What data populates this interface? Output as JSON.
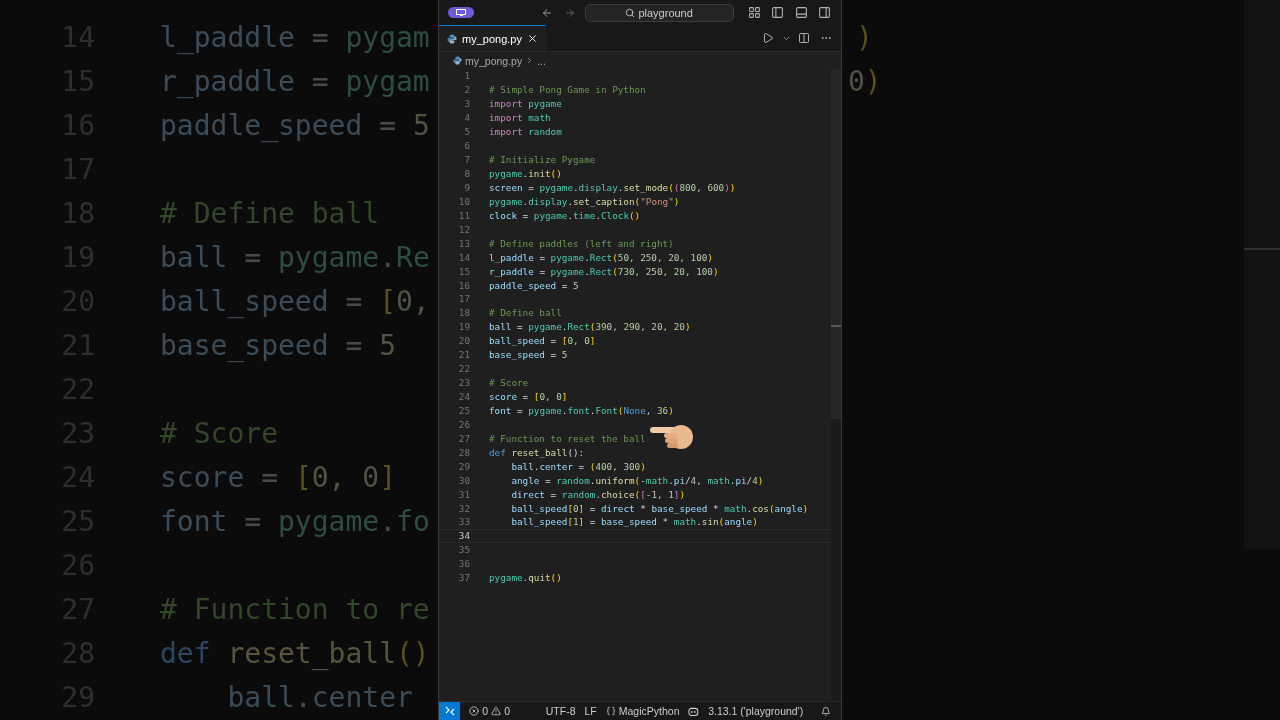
{
  "background": {
    "left_lines": [
      {
        "number": "14",
        "tokens": [
          {
            "text": "l_paddle",
            "kind": "variable"
          },
          {
            "text": " = ",
            "kind": "plain"
          },
          {
            "text": "pygam",
            "kind": "module"
          }
        ]
      },
      {
        "number": "15",
        "tokens": [
          {
            "text": "r_paddle",
            "kind": "variable"
          },
          {
            "text": " = ",
            "kind": "plain"
          },
          {
            "text": "pygam",
            "kind": "module"
          }
        ]
      },
      {
        "number": "16",
        "tokens": [
          {
            "text": "paddle_speed",
            "kind": "variable"
          },
          {
            "text": " = ",
            "kind": "plain"
          },
          {
            "text": "5",
            "kind": "number"
          }
        ]
      },
      {
        "number": "17"
      },
      {
        "number": "18",
        "tokens": [
          {
            "text": "# Define ball",
            "kind": "comment"
          }
        ]
      },
      {
        "number": "19",
        "tokens": [
          {
            "text": "ball",
            "kind": "variable"
          },
          {
            "text": " = ",
            "kind": "plain"
          },
          {
            "text": "pygame",
            "kind": "module"
          },
          {
            "text": ".",
            "kind": "plain"
          },
          {
            "text": "Re",
            "kind": "module"
          }
        ]
      },
      {
        "number": "20",
        "tokens": [
          {
            "text": "ball_speed",
            "kind": "variable"
          },
          {
            "text": " = ",
            "kind": "plain"
          },
          {
            "text": "[",
            "kind": "bracket"
          },
          {
            "text": "0,",
            "kind": "number"
          }
        ]
      },
      {
        "number": "21",
        "tokens": [
          {
            "text": "base_speed",
            "kind": "variable"
          },
          {
            "text": " = ",
            "kind": "plain"
          },
          {
            "text": "5",
            "kind": "number"
          }
        ]
      },
      {
        "number": "22"
      },
      {
        "number": "23",
        "tokens": [
          {
            "text": "# Score",
            "kind": "comment"
          }
        ]
      },
      {
        "number": "24",
        "tokens": [
          {
            "text": "score",
            "kind": "variable"
          },
          {
            "text": " = ",
            "kind": "plain"
          },
          {
            "text": "[",
            "kind": "bracket"
          },
          {
            "text": "0, 0",
            "kind": "number"
          },
          {
            "text": "]",
            "kind": "bracket"
          }
        ]
      },
      {
        "number": "25",
        "tokens": [
          {
            "text": "font",
            "kind": "variable"
          },
          {
            "text": " = ",
            "kind": "plain"
          },
          {
            "text": "pygame",
            "kind": "module"
          },
          {
            "text": ".",
            "kind": "plain"
          },
          {
            "text": "fo",
            "kind": "module"
          }
        ]
      },
      {
        "number": "26"
      },
      {
        "number": "27",
        "tokens": [
          {
            "text": "# Function to re",
            "kind": "comment"
          }
        ]
      },
      {
        "number": "28",
        "tokens": [
          {
            "text": "def ",
            "kind": "storage"
          },
          {
            "text": "reset_ball",
            "kind": "function"
          },
          {
            "text": "()",
            "kind": "bracket"
          }
        ]
      },
      {
        "number": "29",
        "tokens": [
          {
            "text": "    ball",
            "kind": "variable"
          },
          {
            "text": ".",
            "kind": "plain"
          },
          {
            "text": "center",
            "kind": "variable"
          }
        ]
      }
    ],
    "right_fragments": [
      {
        "tokens": [
          {
            "text": ")",
            "kind": "bracket"
          }
        ]
      },
      {
        "tokens": [
          {
            "text": "0",
            "kind": "number"
          },
          {
            "text": ")",
            "kind": "bracket"
          }
        ]
      }
    ]
  },
  "title_bar": {
    "search": "playground"
  },
  "tabs": [
    {
      "label": "my_pong.py",
      "selected": true
    }
  ],
  "breadcrumb": [
    "my_pong.py",
    "..."
  ],
  "editor": {
    "lines": [
      {
        "number": "1",
        "current": false
      },
      {
        "number": "2",
        "current": false,
        "tokens": [
          {
            "text": "# Simple Pong Game in Python",
            "kind": "comment"
          }
        ]
      },
      {
        "number": "3",
        "current": false,
        "tokens": [
          {
            "text": "import ",
            "kind": "keyword"
          },
          {
            "text": "pygame",
            "kind": "module"
          }
        ]
      },
      {
        "number": "4",
        "current": false,
        "tokens": [
          {
            "text": "import ",
            "kind": "keyword"
          },
          {
            "text": "math",
            "kind": "module"
          }
        ]
      },
      {
        "number": "5",
        "current": false,
        "tokens": [
          {
            "text": "import ",
            "kind": "keyword"
          },
          {
            "text": "random",
            "kind": "module"
          }
        ]
      },
      {
        "number": "6",
        "current": false
      },
      {
        "number": "7",
        "current": false,
        "tokens": [
          {
            "text": "# Initialize Pygame",
            "kind": "comment"
          }
        ]
      },
      {
        "number": "8",
        "current": false,
        "tokens": [
          {
            "text": "pygame",
            "kind": "module"
          },
          {
            "text": ".",
            "kind": "plain"
          },
          {
            "text": "init",
            "kind": "function"
          },
          {
            "text": "()",
            "kind": "bracket"
          }
        ]
      },
      {
        "number": "9",
        "current": false,
        "tokens": [
          {
            "text": "screen",
            "kind": "variable"
          },
          {
            "text": " = ",
            "kind": "plain"
          },
          {
            "text": "pygame",
            "kind": "module"
          },
          {
            "text": ".",
            "kind": "plain"
          },
          {
            "text": "display",
            "kind": "module"
          },
          {
            "text": ".",
            "kind": "plain"
          },
          {
            "text": "set_mode",
            "kind": "function"
          },
          {
            "text": "(",
            "kind": "bracket"
          },
          {
            "text": "(",
            "kind": "inner_bracket"
          },
          {
            "text": "800",
            "kind": "number"
          },
          {
            "text": ", ",
            "kind": "plain"
          },
          {
            "text": "600",
            "kind": "number"
          },
          {
            "text": ")",
            "kind": "inner_bracket"
          },
          {
            "text": ")",
            "kind": "bracket"
          }
        ]
      },
      {
        "number": "10",
        "current": false,
        "tokens": [
          {
            "text": "pygame",
            "kind": "module"
          },
          {
            "text": ".",
            "kind": "plain"
          },
          {
            "text": "display",
            "kind": "module"
          },
          {
            "text": ".",
            "kind": "plain"
          },
          {
            "text": "set_caption",
            "kind": "function"
          },
          {
            "text": "(",
            "kind": "bracket"
          },
          {
            "text": "\"Pong\"",
            "kind": "string"
          },
          {
            "text": ")",
            "kind": "bracket"
          }
        ]
      },
      {
        "number": "11",
        "current": false,
        "tokens": [
          {
            "text": "clock",
            "kind": "variable"
          },
          {
            "text": " = ",
            "kind": "plain"
          },
          {
            "text": "pygame",
            "kind": "module"
          },
          {
            "text": ".",
            "kind": "plain"
          },
          {
            "text": "time",
            "kind": "module"
          },
          {
            "text": ".",
            "kind": "plain"
          },
          {
            "text": "Clock",
            "kind": "module"
          },
          {
            "text": "()",
            "kind": "bracket"
          }
        ]
      },
      {
        "number": "12",
        "current": false
      },
      {
        "number": "13",
        "current": false,
        "tokens": [
          {
            "text": "# Define paddles (left and right)",
            "kind": "comment"
          }
        ]
      },
      {
        "number": "14",
        "current": false,
        "tokens": [
          {
            "text": "l_paddle",
            "kind": "variable"
          },
          {
            "text": " = ",
            "kind": "plain"
          },
          {
            "text": "pygame",
            "kind": "module"
          },
          {
            "text": ".",
            "kind": "plain"
          },
          {
            "text": "Rect",
            "kind": "module"
          },
          {
            "text": "(",
            "kind": "bracket"
          },
          {
            "text": "50, 250, 20, 100",
            "kind": "number"
          },
          {
            "text": ")",
            "kind": "bracket"
          }
        ]
      },
      {
        "number": "15",
        "current": false,
        "tokens": [
          {
            "text": "r_paddle",
            "kind": "variable"
          },
          {
            "text": " = ",
            "kind": "plain"
          },
          {
            "text": "pygame",
            "kind": "module"
          },
          {
            "text": ".",
            "kind": "plain"
          },
          {
            "text": "Rect",
            "kind": "module"
          },
          {
            "text": "(",
            "kind": "bracket"
          },
          {
            "text": "730, 250, 20, 100",
            "kind": "number"
          },
          {
            "text": ")",
            "kind": "bracket"
          }
        ]
      },
      {
        "number": "16",
        "current": false,
        "tokens": [
          {
            "text": "paddle_speed",
            "kind": "variable"
          },
          {
            "text": " = ",
            "kind": "plain"
          },
          {
            "text": "5",
            "kind": "number"
          }
        ]
      },
      {
        "number": "17",
        "current": false
      },
      {
        "number": "18",
        "current": false,
        "tokens": [
          {
            "text": "# Define ball",
            "kind": "comment"
          }
        ]
      },
      {
        "number": "19",
        "current": false,
        "tokens": [
          {
            "text": "ball",
            "kind": "variable"
          },
          {
            "text": " = ",
            "kind": "plain"
          },
          {
            "text": "pygame",
            "kind": "module"
          },
          {
            "text": ".",
            "kind": "plain"
          },
          {
            "text": "Rect",
            "kind": "module"
          },
          {
            "text": "(",
            "kind": "bracket"
          },
          {
            "text": "390, 290, 20, 20",
            "kind": "number"
          },
          {
            "text": ")",
            "kind": "bracket"
          }
        ]
      },
      {
        "number": "20",
        "current": false,
        "tokens": [
          {
            "text": "ball_speed",
            "kind": "variable"
          },
          {
            "text": " = ",
            "kind": "plain"
          },
          {
            "text": "[",
            "kind": "bracket"
          },
          {
            "text": "0, 0",
            "kind": "number"
          },
          {
            "text": "]",
            "kind": "bracket"
          }
        ]
      },
      {
        "number": "21",
        "current": false,
        "tokens": [
          {
            "text": "base_speed",
            "kind": "variable"
          },
          {
            "text": " = ",
            "kind": "plain"
          },
          {
            "text": "5",
            "kind": "number"
          }
        ]
      },
      {
        "number": "22",
        "current": false
      },
      {
        "number": "23",
        "current": false,
        "tokens": [
          {
            "text": "# Score",
            "kind": "comment"
          }
        ]
      },
      {
        "number": "24",
        "current": false,
        "tokens": [
          {
            "text": "score",
            "kind": "variable"
          },
          {
            "text": " = ",
            "kind": "plain"
          },
          {
            "text": "[",
            "kind": "bracket"
          },
          {
            "text": "0, 0",
            "kind": "number"
          },
          {
            "text": "]",
            "kind": "bracket"
          }
        ]
      },
      {
        "number": "25",
        "current": false,
        "tokens": [
          {
            "text": "font",
            "kind": "variable"
          },
          {
            "text": " = ",
            "kind": "plain"
          },
          {
            "text": "pygame",
            "kind": "module"
          },
          {
            "text": ".",
            "kind": "plain"
          },
          {
            "text": "font",
            "kind": "module"
          },
          {
            "text": ".",
            "kind": "plain"
          },
          {
            "text": "Font",
            "kind": "module"
          },
          {
            "text": "(",
            "kind": "bracket"
          },
          {
            "text": "None",
            "kind": "storage"
          },
          {
            "text": ", ",
            "kind": "plain"
          },
          {
            "text": "36",
            "kind": "number"
          },
          {
            "text": ")",
            "kind": "bracket"
          }
        ]
      },
      {
        "number": "26",
        "current": false
      },
      {
        "number": "27",
        "current": false,
        "tokens": [
          {
            "text": "# Function to reset the ball",
            "kind": "comment"
          }
        ]
      },
      {
        "number": "28",
        "current": false,
        "tokens": [
          {
            "text": "def ",
            "kind": "storage"
          },
          {
            "text": "reset_ball",
            "kind": "function"
          },
          {
            "text": "():",
            "kind": "plain"
          }
        ]
      },
      {
        "number": "29",
        "current": false,
        "tokens": [
          {
            "text": "    ball",
            "kind": "variable"
          },
          {
            "text": ".",
            "kind": "plain"
          },
          {
            "text": "center",
            "kind": "variable"
          },
          {
            "text": " = ",
            "kind": "plain"
          },
          {
            "text": "(",
            "kind": "bracket"
          },
          {
            "text": "400, 300",
            "kind": "number"
          },
          {
            "text": ")",
            "kind": "bracket"
          }
        ]
      },
      {
        "number": "30",
        "current": false,
        "tokens": [
          {
            "text": "    angle",
            "kind": "variable"
          },
          {
            "text": " = ",
            "kind": "plain"
          },
          {
            "text": "random",
            "kind": "module"
          },
          {
            "text": ".",
            "kind": "plain"
          },
          {
            "text": "uniform",
            "kind": "function"
          },
          {
            "text": "(",
            "kind": "bracket"
          },
          {
            "text": "-",
            "kind": "plain"
          },
          {
            "text": "math",
            "kind": "module"
          },
          {
            "text": ".",
            "kind": "plain"
          },
          {
            "text": "pi",
            "kind": "variable"
          },
          {
            "text": "/",
            "kind": "plain"
          },
          {
            "text": "4",
            "kind": "number"
          },
          {
            "text": ", ",
            "kind": "plain"
          },
          {
            "text": "math",
            "kind": "module"
          },
          {
            "text": ".",
            "kind": "plain"
          },
          {
            "text": "pi",
            "kind": "variable"
          },
          {
            "text": "/",
            "kind": "plain"
          },
          {
            "text": "4",
            "kind": "number"
          },
          {
            "text": ")",
            "kind": "bracket"
          }
        ]
      },
      {
        "number": "31",
        "current": false,
        "tokens": [
          {
            "text": "    direct",
            "kind": "variable"
          },
          {
            "text": " = ",
            "kind": "plain"
          },
          {
            "text": "random",
            "kind": "module"
          },
          {
            "text": ".",
            "kind": "plain"
          },
          {
            "text": "choice",
            "kind": "function"
          },
          {
            "text": "(",
            "kind": "bracket"
          },
          {
            "text": "[",
            "kind": "inner_bracket"
          },
          {
            "text": "-1, 1",
            "kind": "number"
          },
          {
            "text": "]",
            "kind": "inner_bracket"
          },
          {
            "text": ")",
            "kind": "bracket"
          }
        ]
      },
      {
        "number": "32",
        "current": false,
        "tokens": [
          {
            "text": "    ball_speed",
            "kind": "variable"
          },
          {
            "text": "[",
            "kind": "bracket"
          },
          {
            "text": "0",
            "kind": "number"
          },
          {
            "text": "]",
            "kind": "bracket"
          },
          {
            "text": " = ",
            "kind": "plain"
          },
          {
            "text": "direct",
            "kind": "variable"
          },
          {
            "text": " * ",
            "kind": "plain"
          },
          {
            "text": "base_speed",
            "kind": "variable"
          },
          {
            "text": " * ",
            "kind": "plain"
          },
          {
            "text": "math",
            "kind": "module"
          },
          {
            "text": ".",
            "kind": "plain"
          },
          {
            "text": "cos",
            "kind": "function"
          },
          {
            "text": "(",
            "kind": "bracket"
          },
          {
            "text": "angle",
            "kind": "variable"
          },
          {
            "text": ")",
            "kind": "bracket"
          }
        ]
      },
      {
        "number": "33",
        "current": false,
        "tokens": [
          {
            "text": "    ball_speed",
            "kind": "variable"
          },
          {
            "text": "[",
            "kind": "bracket"
          },
          {
            "text": "1",
            "kind": "number"
          },
          {
            "text": "]",
            "kind": "bracket"
          },
          {
            "text": " = ",
            "kind": "plain"
          },
          {
            "text": "base_speed",
            "kind": "variable"
          },
          {
            "text": " * ",
            "kind": "plain"
          },
          {
            "text": "math",
            "kind": "module"
          },
          {
            "text": ".",
            "kind": "plain"
          },
          {
            "text": "sin",
            "kind": "function"
          },
          {
            "text": "(",
            "kind": "bracket"
          },
          {
            "text": "angle",
            "kind": "variable"
          },
          {
            "text": ")",
            "kind": "bracket"
          }
        ]
      },
      {
        "number": "34",
        "current": true
      },
      {
        "number": "35",
        "current": false
      },
      {
        "number": "36",
        "current": false
      },
      {
        "number": "37",
        "current": false,
        "tokens": [
          {
            "text": "pygame",
            "kind": "module"
          },
          {
            "text": ".",
            "kind": "plain"
          },
          {
            "text": "quit",
            "kind": "function"
          },
          {
            "text": "()",
            "kind": "bracket"
          }
        ]
      }
    ]
  },
  "status_bar": {
    "errors": "0",
    "warnings": "0",
    "encoding": "UTF-8",
    "eol": "LF",
    "language": "MagicPython",
    "interpreter": "3.13.1 ('playground')"
  }
}
